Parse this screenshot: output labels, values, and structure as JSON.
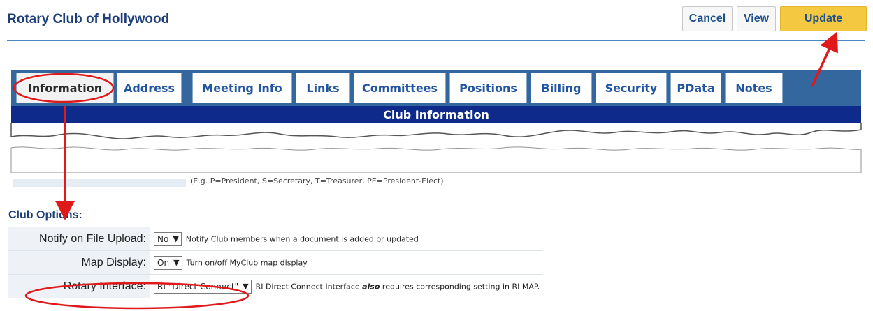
{
  "header": {
    "title": "Rotary Club of Hollywood",
    "buttons": {
      "cancel": "Cancel",
      "view": "View",
      "update": "Update"
    }
  },
  "tabs": [
    "Information",
    "Address",
    "Meeting Info",
    "Links",
    "Committees",
    "Positions",
    "Billing",
    "Security",
    "PData",
    "Notes"
  ],
  "active_tab": "Information",
  "section_header": "Club Information",
  "partial_hint": "(E.g. P=President, S=Secretary, T=Treasurer, PE=President-Elect)",
  "club_options": {
    "title": "Club Options:",
    "rows": [
      {
        "label": "Notify on File Upload:",
        "value": "No",
        "description": "Notify Club members when a document is added or updated"
      },
      {
        "label": "Map Display:",
        "value": "On",
        "description": "Turn on/off MyClub map display"
      },
      {
        "label": "Rotary Interface:",
        "value": "RI \"Direct Connect\"",
        "description_pre": "RI Direct Connect Interface ",
        "description_em": "also",
        "description_post": " requires corresponding setting in RI MAP."
      }
    ]
  },
  "colors": {
    "brand": "#1f3f7a",
    "tabbar": "#34679d",
    "section_bar": "#0e2a8a",
    "update_button": "#f5c842",
    "annotation": "#e0191b"
  }
}
